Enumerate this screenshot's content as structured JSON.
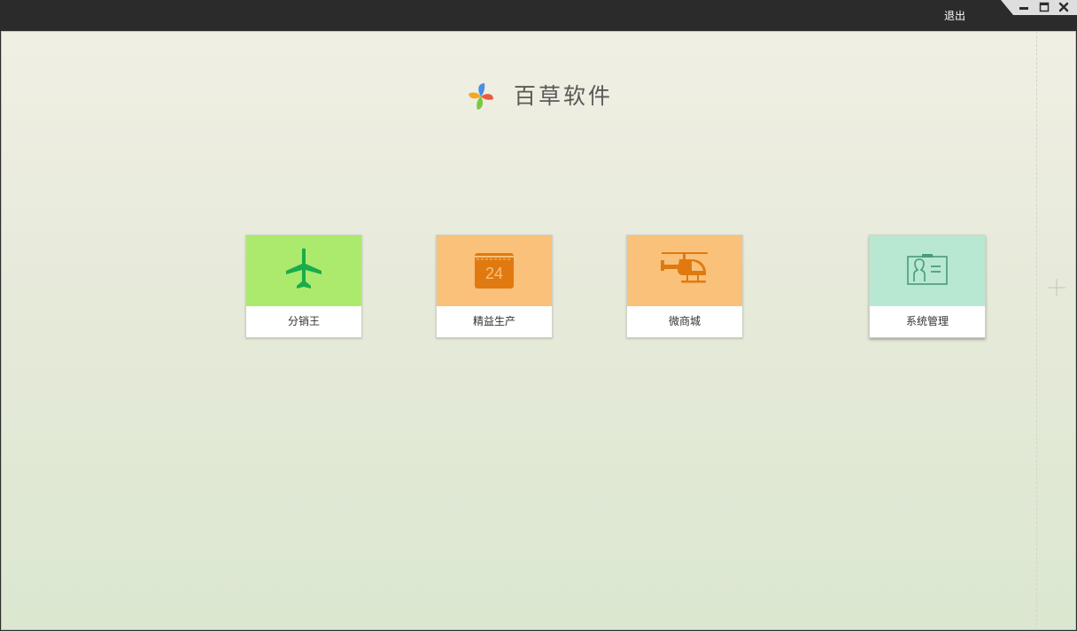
{
  "titlebar": {
    "logout_label": "退出",
    "controls": [
      {
        "name": "minimize",
        "icon": "minimize-icon"
      },
      {
        "name": "maximize",
        "icon": "maximize-icon"
      },
      {
        "name": "close",
        "icon": "close-icon"
      }
    ]
  },
  "brand": {
    "name": "百草软件",
    "logo_icon": "pinwheel-logo-icon",
    "logo_colors": [
      "#4a90e2",
      "#e85c3f",
      "#7ac943",
      "#f5a623"
    ]
  },
  "tiles": [
    {
      "label": "分销王",
      "icon": "airplane-icon",
      "bg_color": "#acea6e",
      "icon_color": "#1aac4a"
    },
    {
      "label": "精益生产",
      "icon": "calendar-icon",
      "icon_text": "24",
      "bg_color": "#f9c17a",
      "icon_color": "#e07a10"
    },
    {
      "label": "微商城",
      "icon": "helicopter-icon",
      "bg_color": "#f9c17a",
      "icon_color": "#e07a10"
    },
    {
      "label": "系统管理",
      "icon": "id-card-icon",
      "bg_color": "#b8e8d2",
      "icon_color": "#4a9a76"
    }
  ],
  "add_icon": "plus-icon"
}
